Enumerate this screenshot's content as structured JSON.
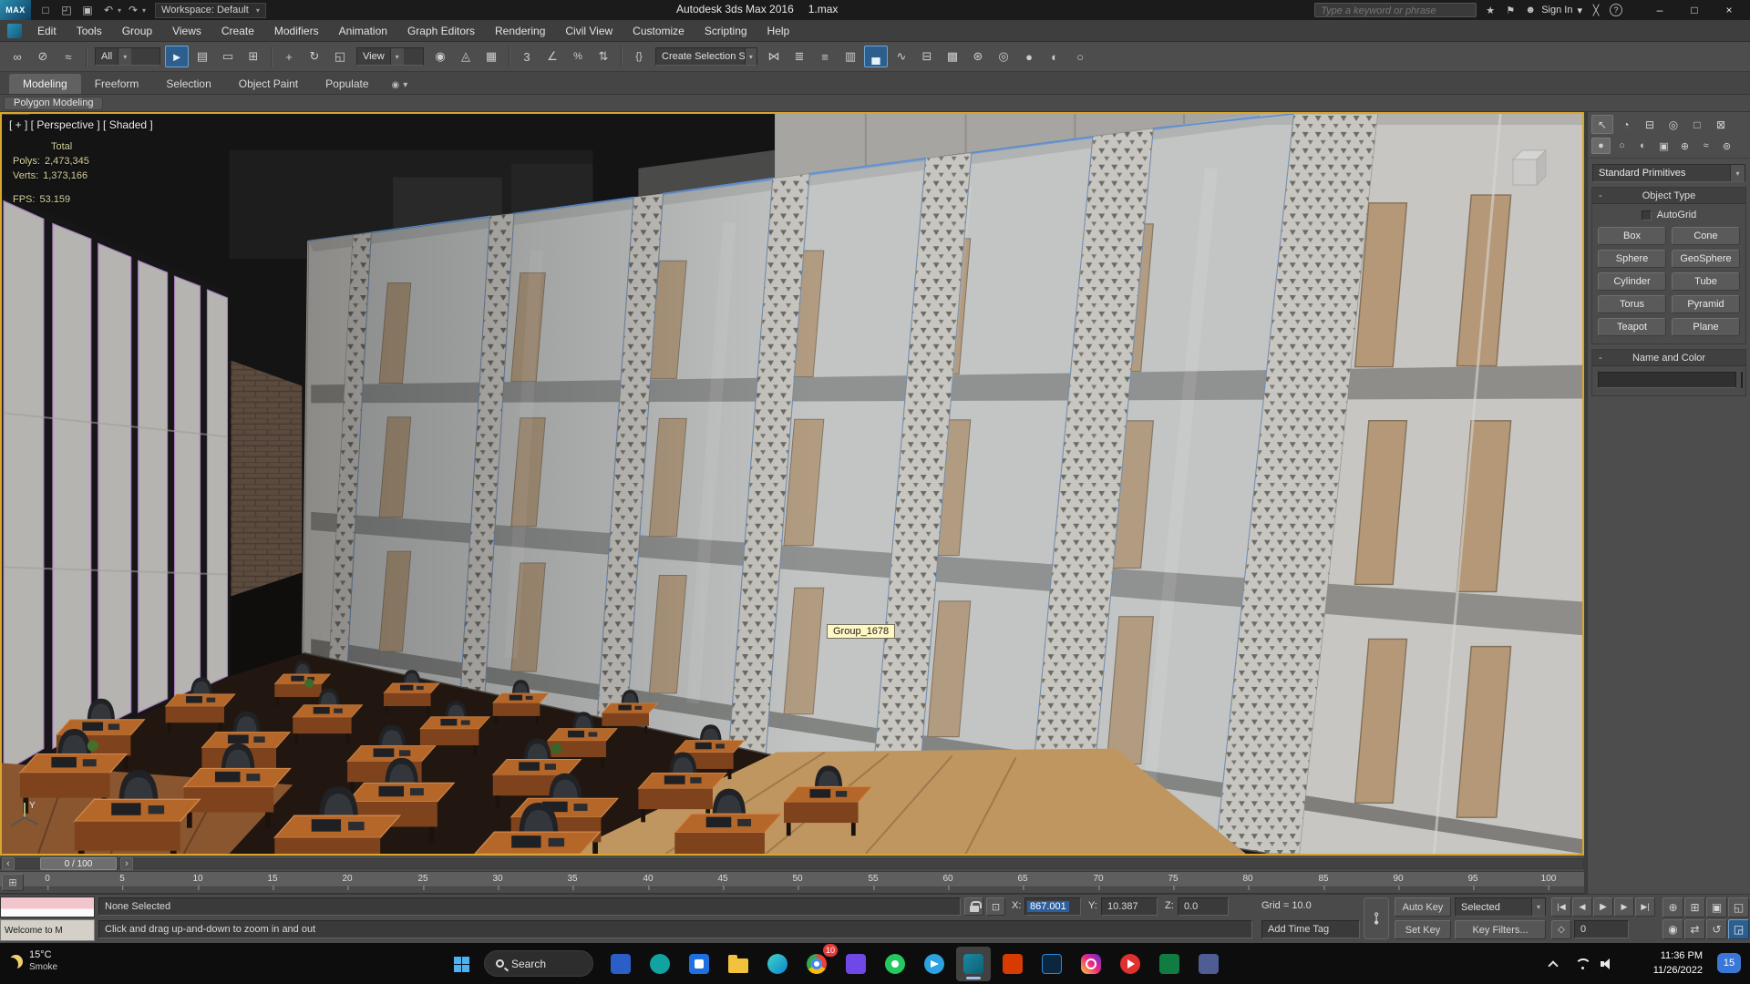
{
  "titlebar": {
    "logo": "MAX",
    "workspace_label": "Workspace: Default",
    "app_title": "Autodesk 3ds Max 2016",
    "doc_name": "1.max",
    "search_placeholder": "Type a keyword or phrase",
    "sign_in_label": "Sign In"
  },
  "menubar": {
    "items": [
      "Edit",
      "Tools",
      "Group",
      "Views",
      "Create",
      "Modifiers",
      "Animation",
      "Graph Editors",
      "Rendering",
      "Civil View",
      "Customize",
      "Scripting",
      "Help"
    ]
  },
  "toolbar": {
    "selection_filter": "All",
    "coord_system": "View",
    "named_sets": "Create Selection Se"
  },
  "ribbon": {
    "tabs": [
      "Modeling",
      "Freeform",
      "Selection",
      "Object Paint",
      "Populate"
    ]
  },
  "modeling_bar": {
    "label": "Polygon Modeling"
  },
  "viewport": {
    "label": "[ + ] [ Perspective ] [ Shaded ]",
    "stats": {
      "total": "Total",
      "polys_label": "Polys:",
      "polys_value": "2,473,345",
      "verts_label": "Verts:",
      "verts_value": "1,373,166",
      "fps_label": "FPS:",
      "fps_value": "53.159"
    },
    "tooltip": "Group_1678",
    "axis_label": "Y"
  },
  "command_panel": {
    "primitive_dropdown": "Standard Primitives",
    "object_type_title": "Object Type",
    "autogrid_label": "AutoGrid",
    "buttons": [
      "Box",
      "Cone",
      "Sphere",
      "GeoSphere",
      "Cylinder",
      "Tube",
      "Torus",
      "Pyramid",
      "Teapot",
      "Plane"
    ],
    "name_color_title": "Name and Color"
  },
  "timeline": {
    "slider_label": "0 / 100",
    "ticks": [
      "0",
      "5",
      "10",
      "15",
      "20",
      "25",
      "30",
      "35",
      "40",
      "45",
      "50",
      "55",
      "60",
      "65",
      "70",
      "75",
      "80",
      "85",
      "90",
      "95",
      "100"
    ]
  },
  "statusbar": {
    "welcome_window": "Welcome to M",
    "selection_status": "None Selected",
    "prompt": "Click and drag up-and-down to zoom in and out",
    "x_label": "X:",
    "x_value": "867.001",
    "y_label": "Y:",
    "y_value": "10.387",
    "z_label": "Z:",
    "z_value": "0.0",
    "grid_label": "Grid = 10.0",
    "time_tag_label": "Add Time Tag",
    "auto_key_label": "Auto Key",
    "set_key_label": "Set Key",
    "key_mode_dropdown": "Selected",
    "key_filters_label": "Key Filters...",
    "frame_value": "0"
  },
  "taskbar": {
    "weather_temp": "15°C",
    "weather_condition": "Smoke",
    "search_label": "Search",
    "chrome_badge": "10",
    "clock_time": "11:36 PM",
    "clock_date": "11/26/2022",
    "notification_count": "15"
  },
  "colors": {
    "viewport_border": "#d8a62d",
    "selection_blue": "#5d8fd2",
    "object_swatch_pink": "#d6419b",
    "table_wood": "#b5672a",
    "badge_red": "#e23b3b"
  },
  "icons": {
    "minus": "-",
    "caret_down": "▾",
    "new_scene": "□",
    "open_file": "◰",
    "save_file": "▣",
    "undo": "↶",
    "redo": "↷",
    "select_and_link": "∞",
    "unlink_selection": "⊘",
    "bind_space_warp": "≈",
    "select_object": "►",
    "select_by_name": "▤",
    "selection_region": "▭",
    "window_crossing": "⊞",
    "select_move": "+",
    "select_rotate": "↻",
    "select_scale": "◱",
    "use_pivot_center": "◉",
    "select_manipulate": "◬",
    "keyboard_override": "▦",
    "snap_3d": "3",
    "angle_snap": "∠",
    "percent_snap": "%",
    "spinner_snap": "⇅",
    "named_sets": "{}",
    "mirror": "⋈",
    "align": "≣",
    "ribbon_toggle": "▄",
    "scene_explorer": "≡",
    "layer_manager": "▥",
    "curve_editor": "∿",
    "schematic_view": "⊟",
    "material_editor": "▩",
    "render_setup": "⊛",
    "rendered_frame": "◎",
    "render_production": "●",
    "lighting_analysis": "◐",
    "render_flyout": "○",
    "star": "★",
    "flag": "⚑",
    "avatar": "☻",
    "a360": "╳",
    "help": "?",
    "minimize": "–",
    "maximize": "□",
    "close": "×",
    "ribbon_cycle": "◉",
    "cp_create": "↖",
    "cp_modify": "◔",
    "cp_hierarchy": "⊟",
    "cp_motion": "◎",
    "cp_display": "□",
    "cp_utilities": "⊠",
    "cat_geometry": "●",
    "cat_shapes": "○",
    "cat_lights": "◐",
    "cat_cameras": "▣",
    "cat_helpers": "⊕",
    "cat_spacewarps": "≈",
    "cat_systems": "⊚",
    "mini_curve_editor": "⊞",
    "prev_frame_sm": "‹",
    "next_frame_sm": "›",
    "abs_offset": "⊡",
    "set_key_big": "⊶",
    "go_start": "|◀",
    "prev_frame": "◀",
    "play": "▶",
    "next_frame": "▶",
    "go_end": "▶|",
    "key_mode": "◇",
    "zoom": "⊕",
    "zoom_all": "⊞",
    "zoom_extents": "▣",
    "zoom_region": "◱",
    "fov": "◉",
    "pan": "⇄",
    "orbit": "↺",
    "max_viewport": "◲"
  }
}
